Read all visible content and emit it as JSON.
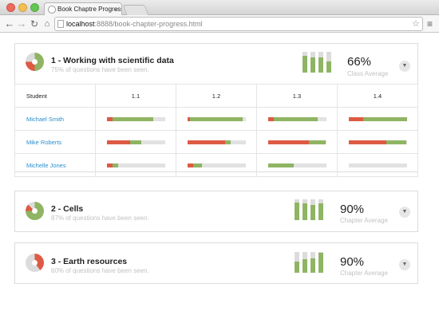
{
  "browser": {
    "tab_title": "Book Chaptre Progress",
    "tab_close": "×",
    "url_host": "localhost",
    "url_rest": ":8888/book-chapter-progress.html",
    "back_icon": "arrow-left-icon",
    "forward_icon": "arrow-right-icon",
    "reload_icon": "reload-icon",
    "home_icon": "home-icon",
    "star_icon": "star-icon",
    "menu_icon": "menu-icon"
  },
  "colors": {
    "red": "#dd5a43",
    "green": "#8fb463",
    "track": "#e2e2e2",
    "link": "#2a8fd0"
  },
  "chapters": [
    {
      "title": "1 - Working with scientific data",
      "subtitle": "75% of questions have been seen.",
      "average_value": "66%",
      "average_label": "Class Average",
      "pie": {
        "green": 0.5,
        "red": 0.25,
        "empty": 0.25
      },
      "mini_bars": [
        0.8,
        0.75,
        0.75,
        0.55
      ],
      "expanded": true,
      "table": {
        "header_student": "Student",
        "columns": [
          "1.1",
          "1.2",
          "1.3",
          "1.4"
        ],
        "rows": [
          {
            "name": "Michael Smith",
            "cells": [
              {
                "red": 0.1,
                "green": 0.7
              },
              {
                "red": 0.05,
                "green": 0.9
              },
              {
                "red": 0.1,
                "green": 0.75
              },
              {
                "red": 0.25,
                "green": 0.75
              }
            ]
          },
          {
            "name": "Mike Roberts",
            "cells": [
              {
                "red": 0.4,
                "green": 0.2
              },
              {
                "red": 0.65,
                "green": 0.1
              },
              {
                "red": 0.7,
                "green": 0.3
              },
              {
                "red": 0.65,
                "green": 0.35
              }
            ]
          },
          {
            "name": "Michelle Jones",
            "cells": [
              {
                "red": 0.1,
                "green": 0.1
              },
              {
                "red": 0.1,
                "green": 0.15
              },
              {
                "red": 0.0,
                "green": 0.45
              },
              {
                "red": 0.0,
                "green": 0.0
              }
            ]
          }
        ]
      }
    },
    {
      "title": "2 - Cells",
      "subtitle": "87% of questions have been seen.",
      "average_value": "90%",
      "average_label": "Chapter Average",
      "pie": {
        "green": 0.75,
        "red": 0.12,
        "empty": 0.13
      },
      "mini_bars": [
        0.85,
        0.8,
        0.75,
        0.8
      ],
      "expanded": false
    },
    {
      "title": "3 - Earth resources",
      "subtitle": "60% of questions have been seen.",
      "average_value": "90%",
      "average_label": "Chapter Average",
      "pie": {
        "green": 0.0,
        "red": 0.4,
        "empty": 0.6
      },
      "mini_bars": [
        0.55,
        0.65,
        0.7,
        0.95
      ],
      "expanded": false
    }
  ]
}
